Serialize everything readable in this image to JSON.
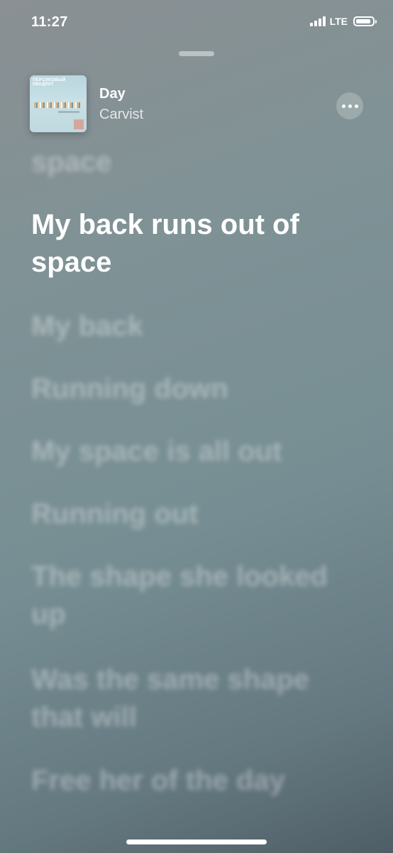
{
  "status_bar": {
    "time": "11:27",
    "network": "LTE"
  },
  "now_playing": {
    "title": "Day",
    "artist": "Carvist",
    "artwork_text": "ПЕРСИКОВЫЙ КВАДРАТ"
  },
  "lyrics": {
    "previous": "space",
    "current": "My back runs out of space",
    "upcoming": [
      "My back",
      "Running down",
      "My space is all out",
      "Running out",
      "The shape she looked up",
      "Was the same shape that will",
      "Free her of the day"
    ]
  }
}
